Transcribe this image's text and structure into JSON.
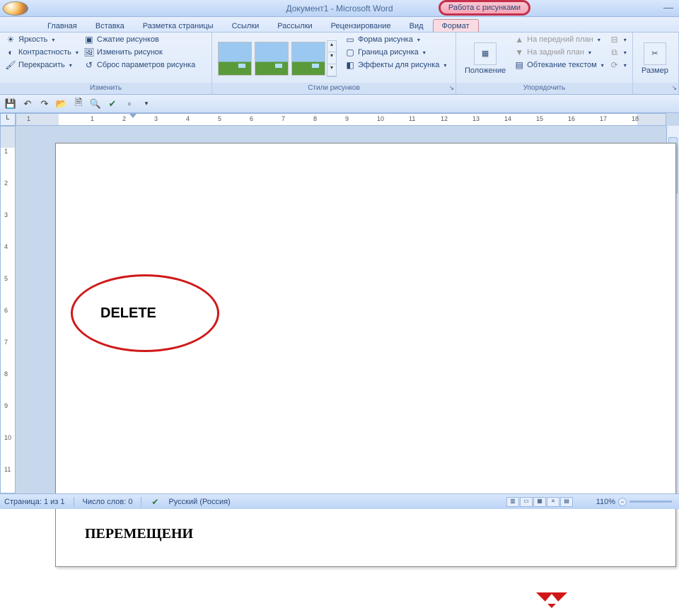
{
  "title": "Документ1 - Microsoft Word",
  "context_title": "Работа с рисунками",
  "tabs": [
    "Главная",
    "Вставка",
    "Разметка страницы",
    "Ссылки",
    "Рассылки",
    "Рецензирование",
    "Вид",
    "Формат"
  ],
  "active_tab": "Формат",
  "ribbon": {
    "adjust": {
      "label": "Изменить",
      "brightness": "Яркость",
      "contrast": "Контрастность",
      "recolor": "Перекрасить",
      "compress": "Сжатие рисунков",
      "change": "Изменить рисунок",
      "reset": "Сброс параметров рисунка"
    },
    "styles": {
      "label": "Стили рисунков",
      "shape": "Форма рисунка",
      "border": "Граница рисунка",
      "effects": "Эффекты для рисунка"
    },
    "arrange": {
      "label": "Упорядочить",
      "position": "Положение",
      "bring_front": "На передний план",
      "send_back": "На задний план",
      "wrap": "Обтекание текстом"
    },
    "size": {
      "label": "Размер"
    }
  },
  "hruler_ticks": [
    "2",
    "1",
    "1",
    "2",
    "3",
    "4",
    "5",
    "6",
    "7",
    "8",
    "9",
    "10",
    "11",
    "12",
    "13",
    "14",
    "15",
    "16",
    "17",
    "18"
  ],
  "vruler_ticks": [
    "1",
    "2",
    "3",
    "4",
    "5",
    "6",
    "7",
    "8",
    "9",
    "10",
    "11"
  ],
  "doc": {
    "ellipse_text": "DELETE",
    "para2": "ПЕРЕМЕЩЕНИ"
  },
  "status": {
    "page": "Страница: 1 из 1",
    "words": "Число слов: 0",
    "lang": "Русский (Россия)",
    "zoom": "110%"
  }
}
